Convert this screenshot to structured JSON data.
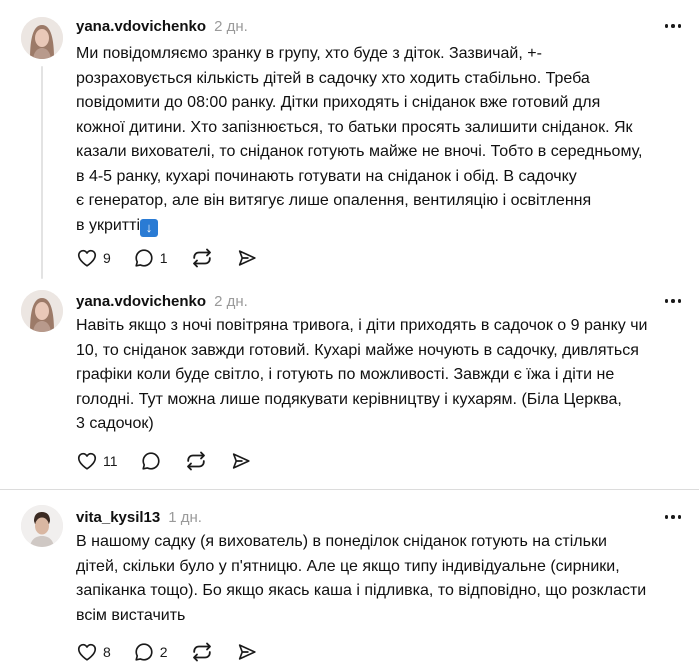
{
  "posts": [
    {
      "username": "yana.vdovichenko",
      "time": "2 дн.",
      "text": "Ми повідомляємо зранку в групу, хто буде з діток. Зазвичай, +-\nрозраховується кількість дітей в садочку хто ходить стабільно. Треба\nповідомити до 08:00 ранку. Дітки приходять і сніданок вже готовий для\nкожної дитини. Хто запізнюється, то батьки просять залишити сніданок. Як\nказали вихователі, то сніданок готують майже не вночі. Тобто в середньому,\nв 4-5 ранку, кухарі починають готувати на сніданок і обід. В садочку\nє генератор, але він витягує лише опалення, вентиляцію і освітлення\nв укритті",
      "emoji": "↓",
      "likes": "9",
      "replies": "1",
      "avatar_icon": "woman-avatar"
    },
    {
      "username": "yana.vdovichenko",
      "time": "2 дн.",
      "text": "Навіть якщо з ночі повітряна тривога, і діти приходять в садочок о 9 ранку чи\n10, то сніданок завжди готовий. Кухарі майже ночують в садочку, дивляться\nграфіки коли буде світло, і готують по можливості. Завжди є їжа і діти не\nголодні. Тут можна лише подякувати керівництву і кухарям. (Біла Церква,\n3 садочок)",
      "likes": "11",
      "replies": "",
      "avatar_icon": "woman-avatar"
    },
    {
      "username": "vita_kysil13",
      "time": "1 дн.",
      "text": "В нашому садку (я вихователь) в понеділок сніданок готують на стільки\nдітей, скільки було у п'ятницю. Але це якщо типу індивідуальне (сирники,\nзапіканка тощо). Бо якщо якась каша і підливка, то відповідно, що розкласти\nвсім вистачить",
      "likes": "8",
      "replies": "2",
      "avatar_icon": "man-avatar"
    }
  ],
  "icons": {
    "like": "heart-icon",
    "reply": "comment-icon",
    "repost": "repost-icon",
    "share": "send-icon",
    "more": "more-icon"
  }
}
